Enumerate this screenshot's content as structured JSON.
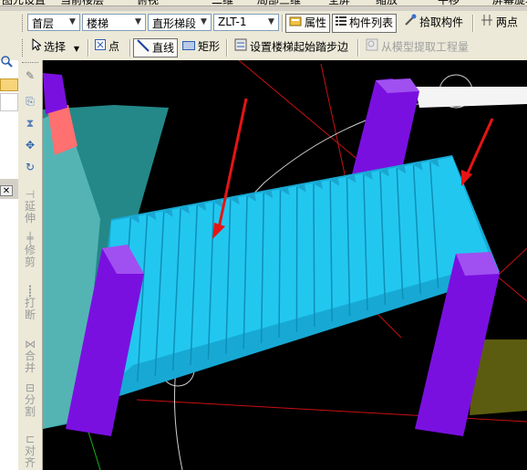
{
  "top_cutoff": {
    "items": [
      "图元设置",
      "当前楼层",
      "俯视",
      "二维",
      "局部三维",
      "全屏",
      "缩放",
      "平移",
      "屏幕旋转"
    ]
  },
  "toolbar1": {
    "floor": "首层",
    "component_type": "楼梯",
    "component_subtype": "直形梯段",
    "component_name": "ZLT-1",
    "properties_label": "属性",
    "component_list_label": "构件列表",
    "pick_component_label": "拾取构件",
    "two_points_label": "两点"
  },
  "toolbar2": {
    "select_label": "选择",
    "point_label": "点",
    "line_label": "直线",
    "rect_label": "矩形",
    "set_start_step_label": "设置楼梯起始踏步边",
    "extract_quantity_label": "从模型提取工程量"
  },
  "vertical_tools": [
    "延伸",
    "修剪",
    "打断",
    "合并",
    "分割",
    "对齐"
  ],
  "colors": {
    "stair": "#22c7f0",
    "column": "#7a10e0",
    "arrow": "#e61414",
    "viewport_bg": "#000000"
  }
}
